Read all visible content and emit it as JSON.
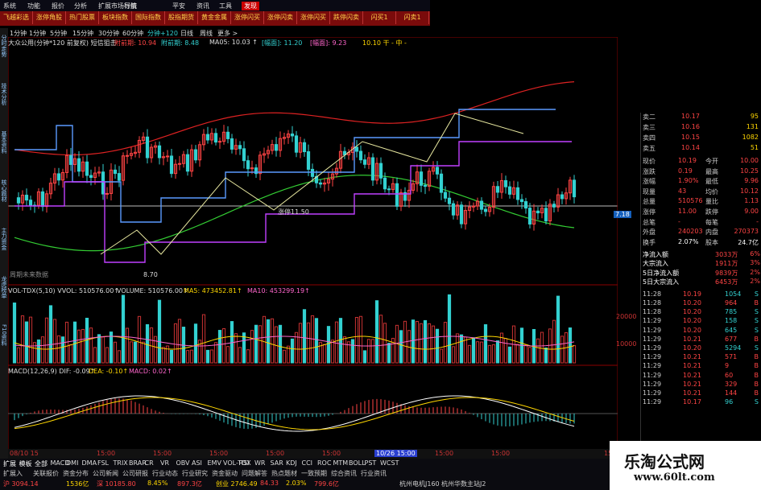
{
  "menubar": [
    "系统",
    "功能",
    "报价",
    "分析",
    "扩展市场行情",
    "导航",
    "平安",
    "资讯",
    "工具",
    "发现"
  ],
  "tabs": [
    "飞越彩选",
    "涨停角股",
    "热门股票",
    "板块指数",
    "国际指数",
    "股指期货",
    "黄金金属",
    "涨停闪买",
    "涨停闪卖",
    "涨停闪买",
    "跌停闪卖",
    "闪买1",
    "闪卖1"
  ],
  "periods": [
    "1分钟",
    "1分钟",
    "5分钟",
    "15分钟",
    "30分钟",
    "60分钟",
    "分钟+120",
    "日线",
    "周线",
    "更多 >"
  ],
  "sidebar": [
    "分时走势",
    "技术分析",
    "基本资料",
    "核心题材",
    "主力资金",
    "龙虎榜单",
    "F10资料"
  ],
  "chart_header": {
    "title": "大众公用(分钟*120 前复权) 短信狙击",
    "val1": "附前期: 10.94",
    "val2": "附前期: 8.48",
    "ma": "MA05: 10.03 ↑",
    "tag1": "[幅面]: 11.20",
    "tag2": "[幅面]: 9.23",
    "tag3": "10.10 干 - 中 -"
  },
  "price_labels": {
    "peak": "涨停11.50",
    "low": "8.70",
    "right": "7.18"
  },
  "note": "周期未来数据",
  "volume_header": {
    "title": "VOL-TDX(5,10) VVOL: 510576.00↑",
    "volume": "VOLUME: 510576.00↑",
    "ma5": "MA5: 473452.81↑",
    "ma10": "MA10: 453299.19↑"
  },
  "volume_ticks": [
    "20000",
    "10000"
  ],
  "macd_header": {
    "title": "MACD(12,26,9) DIF: -0.09↑",
    "dea": "DEA: -0.10↑",
    "macd": "MACD: 0.02↑"
  },
  "xaxis": [
    "08/10 15",
    "15:00",
    "15:00",
    "15:00",
    "15:00",
    "15:00",
    "15:00",
    "15:00",
    "15:00",
    "10/26 15:00",
    "15:00"
  ],
  "quote": {
    "asks": [
      [
        "卖二",
        "10.17",
        "95"
      ],
      [
        "卖三",
        "10.16",
        "131"
      ],
      [
        "卖四",
        "10.15",
        "1082"
      ],
      [
        "卖五",
        "10.14",
        "51"
      ]
    ],
    "stats": [
      [
        "现价",
        "10.19",
        "今开",
        "10.00"
      ],
      [
        "涨跌",
        "0.19",
        "最高",
        "10.25"
      ],
      [
        "涨幅",
        "1.90%",
        "最低",
        "9.96"
      ],
      [
        "现量",
        "43",
        "均价",
        "10.12"
      ],
      [
        "总量",
        "510576",
        "量比",
        "1.13"
      ],
      [
        "涨停",
        "11.00",
        "跌停",
        "9.00"
      ],
      [
        "总笔",
        "-",
        "每笔",
        "-"
      ],
      [
        "外盘",
        "240203",
        "内盘",
        "270373"
      ]
    ],
    "turnover": [
      "换手",
      "2.07%",
      "股本",
      "24.7亿"
    ],
    "flows": [
      [
        "净流入额",
        "3033万",
        "6%"
      ],
      [
        "大宗流入",
        "1911万",
        "3%"
      ],
      [
        "5日净流入额",
        "9839万",
        "2%"
      ],
      [
        "5日大宗流入",
        "6453万",
        "2%"
      ]
    ],
    "ticks": [
      [
        "11:28",
        "10.19",
        "1054",
        "S"
      ],
      [
        "11:28",
        "10.20",
        "964",
        "B"
      ],
      [
        "11:28",
        "10.20",
        "785",
        "S"
      ],
      [
        "11:29",
        "10.20",
        "158",
        "S"
      ],
      [
        "11:29",
        "10.20",
        "645",
        "S"
      ],
      [
        "11:29",
        "10.21",
        "677",
        "B"
      ],
      [
        "11:29",
        "10.20",
        "5294",
        "S"
      ],
      [
        "11:29",
        "10.21",
        "571",
        "B"
      ],
      [
        "11:29",
        "10.21",
        "9",
        "B"
      ],
      [
        "11:29",
        "10.21",
        "60",
        "B"
      ],
      [
        "11:29",
        "10.21",
        "329",
        "B"
      ],
      [
        "11:29",
        "10.21",
        "144",
        "B"
      ],
      [
        "11:29",
        "10.17",
        "96",
        "S"
      ]
    ]
  },
  "bottom": {
    "tabs": [
      "扩展",
      "模板",
      "全部",
      "MACD",
      "DMI",
      "DMA",
      "FSL",
      "TRIX",
      "BRAR",
      "CR",
      "VR",
      "OBV",
      "ASI",
      "EMV",
      "VOL-TDX",
      "RSI",
      "WR",
      "SAR",
      "KDJ",
      "CCI",
      "ROC",
      "MTM",
      "BOLL",
      "PST",
      "WCST"
    ],
    "status": [
      "扩展入",
      "关联报价",
      "资金分布",
      "公司新闻",
      "公司研报",
      "行业动态",
      "行业研究",
      "资金驱动",
      "问题解答",
      "热点题材",
      "一致预期",
      "综合资讯",
      "行业资讯"
    ],
    "index": [
      "沪 3094.14",
      "1536亿",
      "深 10185.80",
      "8.45%",
      "897.3亿",
      "创业 2746.49",
      "84.33",
      "2.03%",
      "799.6亿"
    ],
    "right": [
      "杭州电机J160",
      "杭州华数主站J2"
    ]
  },
  "watermark": {
    "title": "乐淘公式网",
    "url": "www.60lt.com"
  },
  "colors": {
    "rise": "#ff4444",
    "fall": "#33d1d1",
    "yellow": "#ffd700",
    "cyan": "#00e5ff"
  }
}
